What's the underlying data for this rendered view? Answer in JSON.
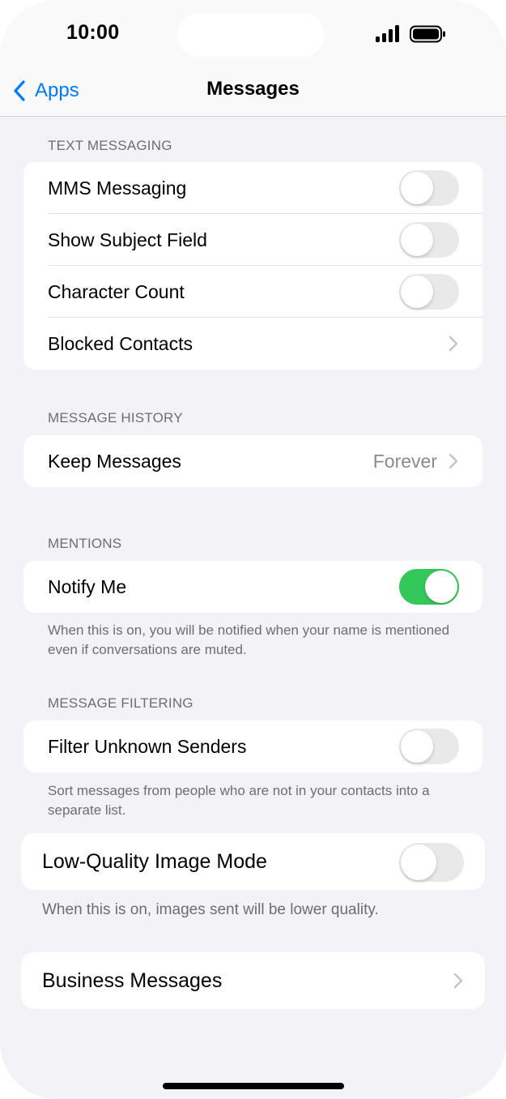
{
  "status": {
    "time": "10:00"
  },
  "nav": {
    "back_label": "Apps",
    "title": "Messages"
  },
  "sections": {
    "text_messaging": {
      "header": "TEXT MESSAGING",
      "mms": {
        "label": "MMS Messaging",
        "on": false
      },
      "subject": {
        "label": "Show Subject Field",
        "on": false
      },
      "char_count": {
        "label": "Character Count",
        "on": false
      },
      "blocked": {
        "label": "Blocked Contacts"
      }
    },
    "message_history": {
      "header": "MESSAGE HISTORY",
      "keep": {
        "label": "Keep Messages",
        "value": "Forever"
      }
    },
    "mentions": {
      "header": "MENTIONS",
      "notify": {
        "label": "Notify Me",
        "on": true
      },
      "footer": "When this is on, you will be notified when your name is mentioned even if conversations are muted."
    },
    "filtering": {
      "header": "MESSAGE FILTERING",
      "filter": {
        "label": "Filter Unknown Senders",
        "on": false
      },
      "footer": "Sort messages from people who are not in your contacts into a separate list."
    },
    "low_quality": {
      "label": "Low-Quality Image Mode",
      "on": false,
      "footer": "When this is on, images sent will be lower quality."
    },
    "business": {
      "label": "Business Messages"
    }
  },
  "colors": {
    "accent": "#007aff",
    "toggle_on": "#34c759",
    "toggle_off": "#e9e9ea",
    "background": "#f2f2f7"
  }
}
